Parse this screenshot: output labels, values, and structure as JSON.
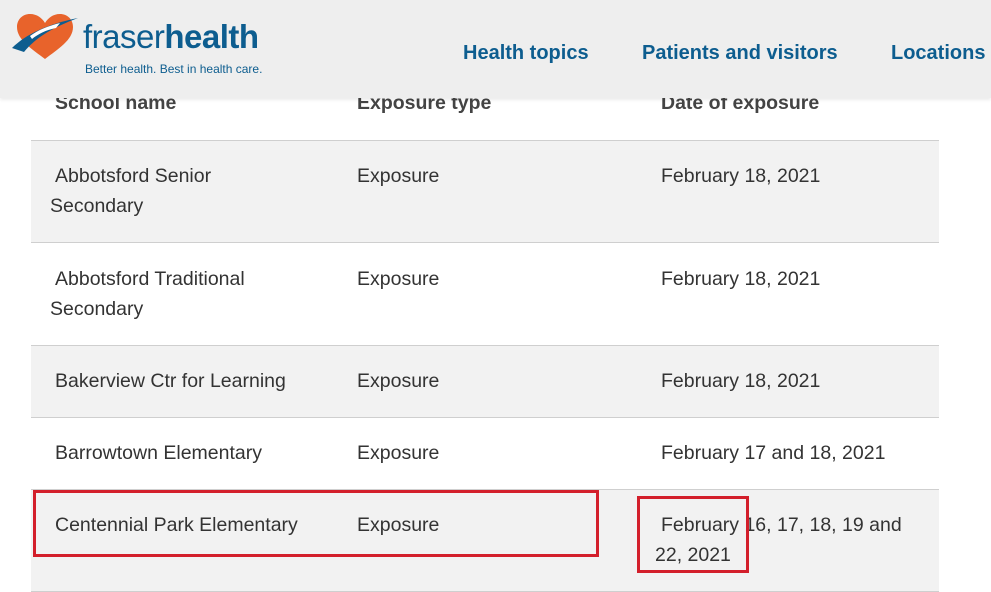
{
  "header": {
    "logo": {
      "word_part1": "fraser",
      "word_part2": "health",
      "tagline": "Better health. Best in health care."
    },
    "nav": [
      {
        "label": "Health topics"
      },
      {
        "label": "Patients and visitors"
      },
      {
        "label": "Locations"
      }
    ]
  },
  "table": {
    "columns": [
      "School name",
      "Exposure type",
      "Date of exposure"
    ],
    "rows": [
      {
        "school": [
          "Abbotsford Senior",
          "Secondary"
        ],
        "type": "Exposure",
        "date": [
          "February 18, 2021"
        ]
      },
      {
        "school": [
          "Abbotsford Traditional",
          "Secondary"
        ],
        "type": "Exposure",
        "date": [
          "February 18, 2021"
        ]
      },
      {
        "school": [
          "Bakerview Ctr for Learning"
        ],
        "type": "Exposure",
        "date": [
          "February 18, 2021"
        ]
      },
      {
        "school": [
          "Barrowtown Elementary"
        ],
        "type": "Exposure",
        "date": [
          "February 17 and 18, 2021"
        ]
      },
      {
        "school": [
          "Centennial Park Elementary"
        ],
        "type": "Exposure",
        "date": [
          "February 16, 17, 18, 19 and",
          "22, 2021"
        ]
      }
    ]
  },
  "colors": {
    "brand_blue": "#0d5d8f",
    "brand_orange": "#e8632b",
    "highlight_red": "#d31f2b",
    "row_shade": "#f2f2f2"
  }
}
